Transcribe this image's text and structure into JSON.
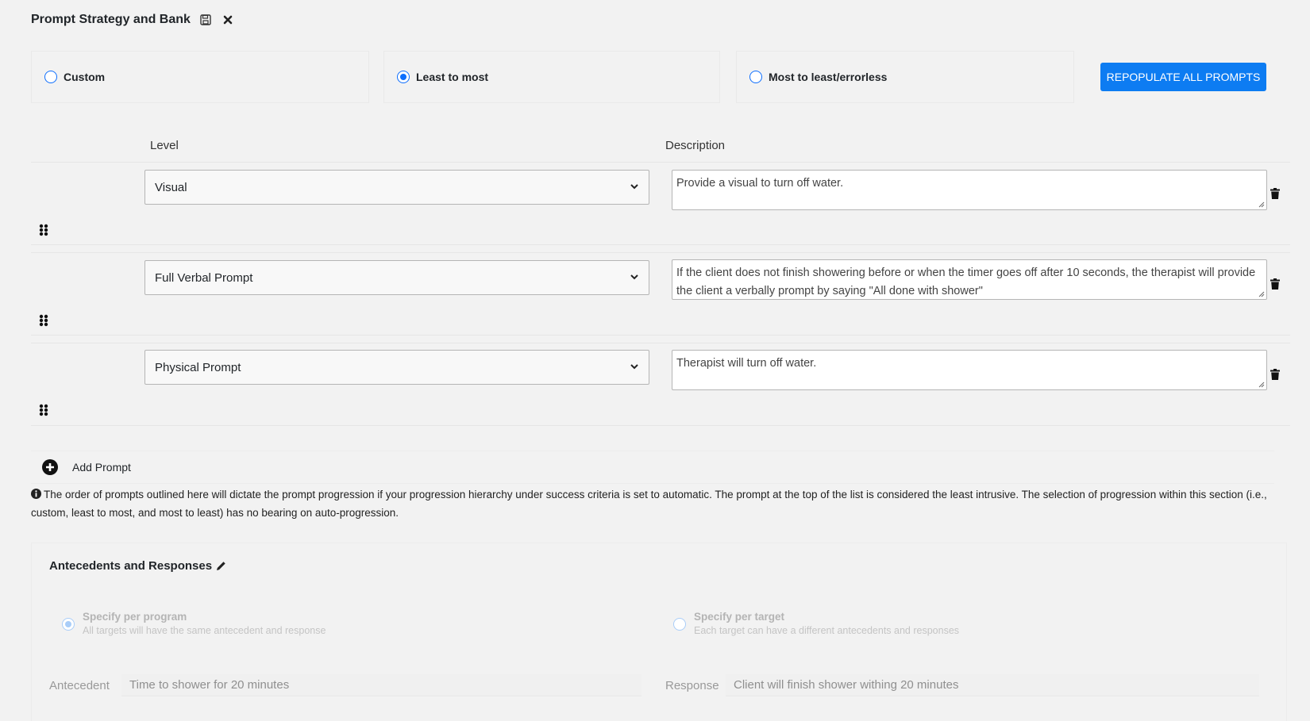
{
  "header": {
    "title": "Prompt Strategy and Bank",
    "save_icon": "save-icon",
    "close_icon": "close-icon"
  },
  "strategy": {
    "options": [
      {
        "label": "Custom",
        "checked": false
      },
      {
        "label": "Least to most",
        "checked": true
      },
      {
        "label": "Most to least/errorless",
        "checked": false
      }
    ],
    "repopulate_label": "REPOPULATE ALL PROMPTS"
  },
  "columns": {
    "level": "Level",
    "description": "Description"
  },
  "prompts": [
    {
      "level": "Visual",
      "description": "Provide a visual to turn off water."
    },
    {
      "level": "Full Verbal Prompt",
      "description": "If the client does not finish showering before or when the timer goes off after 10 seconds, the therapist will provide the client a verbally prompt by saying \"All done with shower\""
    },
    {
      "level": "Physical Prompt",
      "description": "Therapist will turn off water."
    }
  ],
  "add_prompt_label": "Add Prompt",
  "info_text": "The order of prompts outlined here will dictate the prompt progression if your progression hierarchy under success criteria is set to automatic. The prompt at the top of the list is considered the least intrusive. The selection of progression within this section (i.e., custom, least to most, and most to least) has no bearing on auto-progression.",
  "antecedents": {
    "title": "Antecedents and Responses",
    "per_program": {
      "title": "Specify per program",
      "subtitle": "All targets will have the same antecedent and response",
      "checked": true
    },
    "per_target": {
      "title": "Specify per target",
      "subtitle": "Each target can have a different antecedents and responses",
      "checked": false
    },
    "antecedent_label": "Antecedent",
    "antecedent_value": "Time to shower for 20 minutes",
    "response_label": "Response",
    "response_value": "Client will finish shower withing 20 minutes"
  },
  "colors": {
    "accent": "#0d7cf2",
    "radio": "#0d6efd",
    "disabled": "#a9cdf8"
  }
}
